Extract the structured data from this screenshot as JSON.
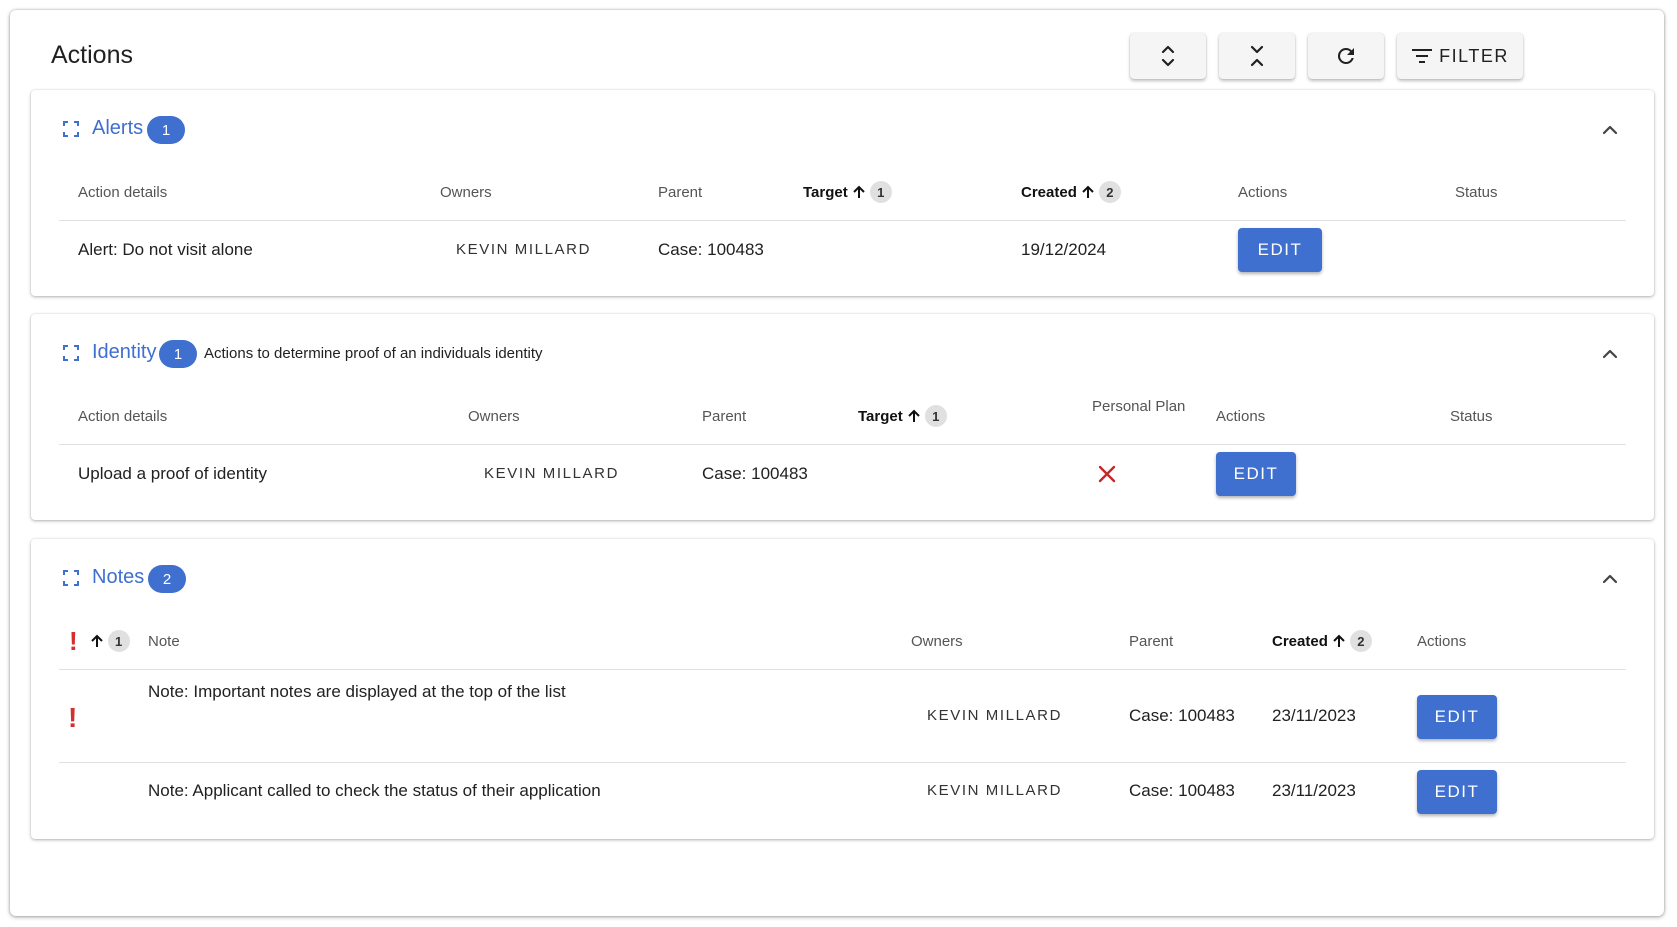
{
  "header": {
    "title": "Actions",
    "filter_label": "FILTER"
  },
  "icons": {
    "expand_all": "unfold-more-icon",
    "collapse_all": "unfold-less-icon",
    "refresh": "refresh-icon",
    "filter": "filter-list-icon",
    "section_expand": "fullscreen-icon",
    "section_collapse": "chevron-up-icon",
    "sort": "arrow-up-icon",
    "plan_no": "close-icon",
    "important": "exclamation-icon"
  },
  "colors": {
    "accent": "#3f6fcf",
    "danger": "#d32f2f"
  },
  "sections": {
    "alerts": {
      "title": "Alerts",
      "count": "1",
      "columns": {
        "details": "Action details",
        "owners": "Owners",
        "parent": "Parent",
        "target": "Target",
        "target_sort": "1",
        "created": "Created",
        "created_sort": "2",
        "actions": "Actions",
        "status": "Status"
      },
      "rows": [
        {
          "details": "Alert: Do not visit alone",
          "owner": "KEVIN MILLARD",
          "parent": "Case: 100483",
          "created": "19/12/2024",
          "edit": "EDIT"
        }
      ]
    },
    "identity": {
      "title": "Identity",
      "count": "1",
      "description": "Actions to determine proof of an individuals identity",
      "columns": {
        "details": "Action details",
        "owners": "Owners",
        "parent": "Parent",
        "target": "Target",
        "target_sort": "1",
        "personal_plan": "Personal Plan",
        "actions": "Actions",
        "status": "Status"
      },
      "rows": [
        {
          "details": "Upload a proof of identity",
          "owner": "KEVIN MILLARD",
          "parent": "Case: 100483",
          "personal_plan": false,
          "edit": "EDIT"
        }
      ]
    },
    "notes": {
      "title": "Notes",
      "count": "2",
      "columns": {
        "important_sort": "1",
        "note": "Note",
        "owners": "Owners",
        "parent": "Parent",
        "created": "Created",
        "created_sort": "2",
        "actions": "Actions"
      },
      "rows": [
        {
          "important": true,
          "note": "Note: Important notes are displayed at the top of the list",
          "owner": "KEVIN MILLARD",
          "parent": "Case: 100483",
          "created": "23/11/2023",
          "edit": "EDIT"
        },
        {
          "important": false,
          "note": "Note: Applicant called to check the status of their application",
          "owner": "KEVIN MILLARD",
          "parent": "Case: 100483",
          "created": "23/11/2023",
          "edit": "EDIT"
        }
      ]
    }
  }
}
